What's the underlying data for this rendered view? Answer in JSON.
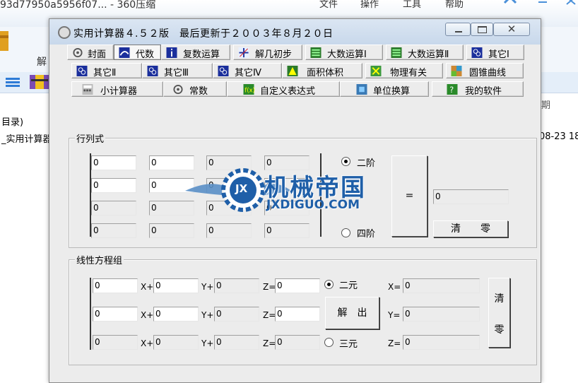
{
  "background": {
    "title": "93d77950a5956f07... - 360压缩",
    "menu": [
      "文件",
      "操作",
      "工具",
      "帮助"
    ],
    "toolbar_label": "解",
    "rows": [
      "目录)",
      "_实用计算器"
    ],
    "date_column": "期",
    "date_value": "08-23 18"
  },
  "dialog": {
    "title": "实用计算器４.５２版　最后更新于２００３年８月２０日",
    "close_symbol": "✕",
    "tabs_row1": [
      "封面",
      "代数",
      "复数运算",
      "解几初步",
      "大数运算Ⅰ",
      "大数运算Ⅱ",
      "其它Ⅰ"
    ],
    "tabs_row2": [
      "其它Ⅱ",
      "其它Ⅲ",
      "其它Ⅳ",
      "面积体积",
      "物理有关",
      "圆锥曲线"
    ],
    "tabs_row3": [
      "小计算器",
      "常数",
      "自定义表达式",
      "单位换算",
      "我的软件"
    ],
    "active_tab": "代数"
  },
  "determinant": {
    "label": "行列式",
    "cells": [
      [
        "0",
        "0",
        "0",
        "0"
      ],
      [
        "0",
        "0",
        "0",
        "0"
      ],
      [
        "0",
        "0",
        "0",
        "0"
      ],
      [
        "0",
        "0",
        "0",
        "0"
      ]
    ],
    "option_2": "二阶",
    "option_4": "四阶",
    "selected": "二阶",
    "equals": "=",
    "result": "0",
    "clear": "清　　零"
  },
  "linear": {
    "label": "线性方程组",
    "row_labels": [
      "X+",
      "Y+",
      "Z="
    ],
    "rows": [
      [
        "0",
        "0",
        "0",
        "0"
      ],
      [
        "0",
        "0",
        "0",
        "0"
      ],
      [
        "0",
        "0",
        "0",
        "0"
      ]
    ],
    "option_2": "二元",
    "option_3": "三元",
    "selected": "二元",
    "solve": "解　出",
    "result_labels": [
      "X=",
      "Y=",
      "Z="
    ],
    "results": [
      "0",
      "0",
      "0"
    ],
    "clear_top": "清",
    "clear_bottom": "零"
  },
  "watermark": {
    "brand": "机械帝国",
    "domain": "JXDIGUO.COM",
    "badge": "JX"
  },
  "colors": {
    "title_bar": "#c8d8eb",
    "dialog_bg": "#ececec",
    "watermark_blue": "#1f5fa8"
  }
}
